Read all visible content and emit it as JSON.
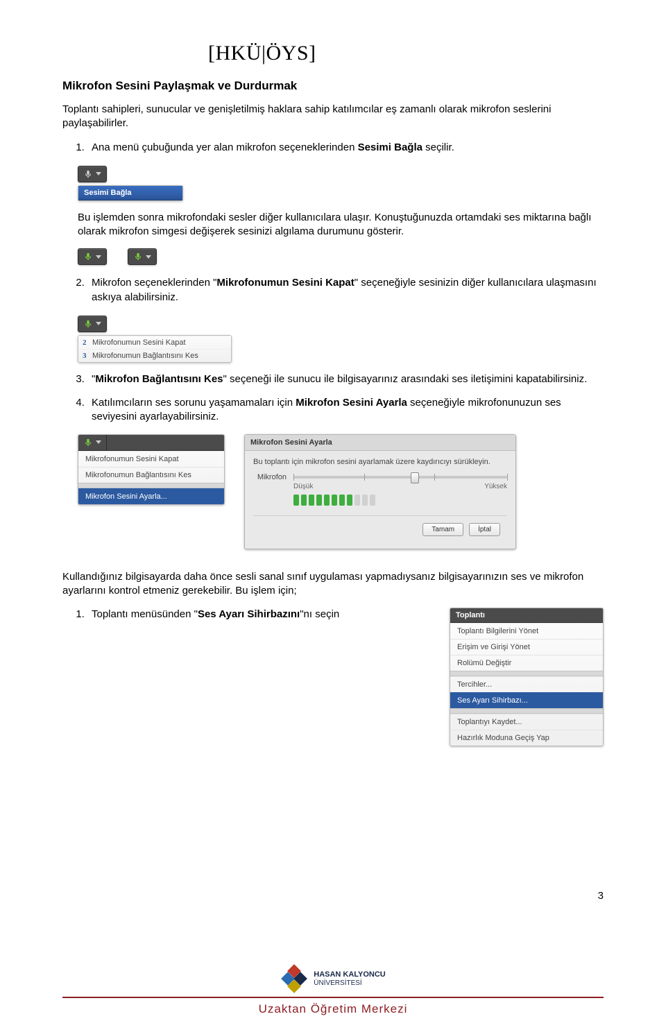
{
  "header": {
    "brand": "[HKÜ|ÖYS]"
  },
  "section": {
    "heading": "Mikrofon Sesini Paylaşmak ve Durdurmak",
    "intro": "Toplantı sahipleri, sunucular ve genişletilmiş haklara sahip katılımcılar eş zamanlı olarak mikrofon seslerini paylaşabilirler.",
    "step1_prefix": "Ana menü çubuğunda yer alan mikrofon seçeneklerinden ",
    "step1_bold": "Sesimi Bağla",
    "step1_suffix": " seçilir.",
    "after1": "Bu işlemden sonra mikrofondaki sesler diğer kullanıcılara ulaşır. Konuştuğunuzda ortamdaki ses miktarına bağlı olarak mikrofon simgesi değişerek sesinizi algılama durumunu gösterir.",
    "step2_prefix": "Mikrofon seçeneklerinden \"",
    "step2_bold": "Mikrofonumun Sesini Kapat",
    "step2_suffix": "\" seçeneğiyle sesinizin diğer kullanıcılara ulaşmasını askıya alabilirsiniz.",
    "step3_prefix": "\"",
    "step3_bold": "Mikrofon Bağlantısını Kes",
    "step3_suffix": "\" seçeneği ile sunucu ile bilgisayarınız arasındaki ses iletişimini kapatabilirsiniz.",
    "step4_prefix": "Katılımcıların ses sorunu yaşamamaları için ",
    "step4_bold": "Mikrofon Sesini Ayarla",
    "step4_suffix": " seçeneğiyle mikrofonunuzun ses seviyesini ayarlayabilirsiniz.",
    "after4": "Kullandığınız bilgisayarda daha önce sesli sanal sınıf uygulaması yapmadıysanız bilgisayarınızın ses ve mikrofon ayarlarını kontrol etmeniz gerekebilir. Bu işlem için;",
    "step5_prefix": "Toplantı menüsünden \"",
    "step5_bold": "Ses Ayarı Sihirbazını",
    "step5_suffix": "\"nı seçin"
  },
  "mock": {
    "dropdown1": {
      "title": "Sesimi Bağla"
    },
    "micOptions": {
      "n2": "2",
      "i2": "Mikrofonumun Sesini Kapat",
      "n3": "3",
      "i3": "Mikrofonumun Bağlantısını Kes"
    },
    "micMenu": {
      "i1": "Mikrofonumun Sesini Kapat",
      "i2": "Mikrofonumun Bağlantısını Kes",
      "i3": "Mikrofon Sesini Ayarla..."
    },
    "dialog": {
      "title": "Mikrofon Sesini Ayarla",
      "desc": "Bu toplantı için mikrofon sesini ayarlamak üzere kaydırıcıyı sürükleyin.",
      "label": "Mikrofon",
      "low": "Düşük",
      "high": "Yüksek",
      "ok": "Tamam",
      "cancel": "İptal"
    },
    "meetingMenu": {
      "header": "Toplantı",
      "i1": "Toplantı Bilgilerini Yönet",
      "i2": "Erişim ve Girişi Yönet",
      "i3": "Rolümü Değiştir",
      "i4": "Tercihler...",
      "i5": "Ses Ayarı Sihirbazı...",
      "i6": "Toplantıyı Kaydet...",
      "i7": "Hazırlık Moduna Geçiş Yap"
    }
  },
  "footer": {
    "uni1": "HASAN KALYONCU",
    "uni2": "ÜNİVERSİTESİ",
    "center": "Uzaktan Öğretim Merkezi",
    "pageno": "3"
  }
}
